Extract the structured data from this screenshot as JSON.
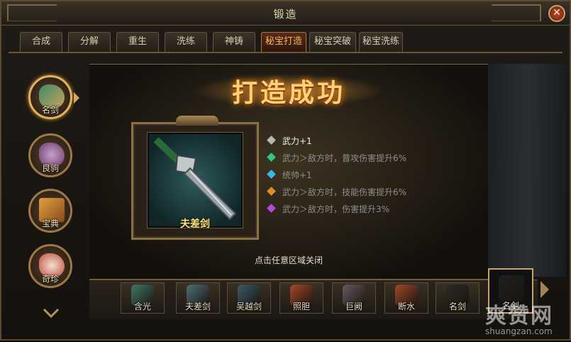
{
  "window": {
    "title": "锻造",
    "close_symbol": "✕"
  },
  "tabs": [
    {
      "label": "合成",
      "active": false
    },
    {
      "label": "分解",
      "active": false
    },
    {
      "label": "重生",
      "active": false
    },
    {
      "label": "洗练",
      "active": false
    },
    {
      "label": "神铸",
      "active": false
    },
    {
      "label": "秘宝打造",
      "active": true
    },
    {
      "label": "秘宝突破",
      "active": false
    },
    {
      "label": "秘宝洗练",
      "active": false
    }
  ],
  "sidebar": {
    "items": [
      {
        "label": "名剑",
        "icon": "sword-icon",
        "active": true
      },
      {
        "label": "良驹",
        "icon": "horse-icon",
        "active": false
      },
      {
        "label": "宝典",
        "icon": "book-icon",
        "active": false
      },
      {
        "label": "奇珍",
        "icon": "feather-icon",
        "active": false
      }
    ]
  },
  "result": {
    "banner": "打造成功",
    "item_name": "夫差剑",
    "stats": [
      {
        "text": "武力+1",
        "gem_color": "#b8b8b8",
        "text_color": "#f2f2f2"
      },
      {
        "text": "武力＞敌方时，普攻伤害提升6%",
        "gem_color": "#2ec68a",
        "text_color": "#8e8e8e"
      },
      {
        "text": "统帅+1",
        "gem_color": "#3fb7e0",
        "text_color": "#8e8e8e"
      },
      {
        "text": "武力＞敌方时，技能伤害提升6%",
        "gem_color": "#e08a2a",
        "text_color": "#8e8e8e"
      },
      {
        "text": "武力＞敌方时，伤害提升3%",
        "gem_color": "#b04ad8",
        "text_color": "#8e8e8e"
      }
    ],
    "close_hint": "点击任意区域关闭"
  },
  "item_bar": {
    "items": [
      {
        "label": "含光",
        "color": "#3f7a6a"
      },
      {
        "label": "夫差剑",
        "color": "#4f6f78"
      },
      {
        "label": "吴越剑",
        "color": "#3a5c6a"
      },
      {
        "label": "照胆",
        "color": "#a8482a"
      },
      {
        "label": "巨阙",
        "color": "#6a5a60"
      },
      {
        "label": "断水",
        "color": "#a04a2a"
      },
      {
        "label": "名剑",
        "color": "#2a2a2a"
      },
      {
        "label": "名剑",
        "color": "#202020",
        "selected": true
      }
    ]
  },
  "watermark": {
    "big": "爽赞网",
    "small": "shuangzan.com"
  }
}
